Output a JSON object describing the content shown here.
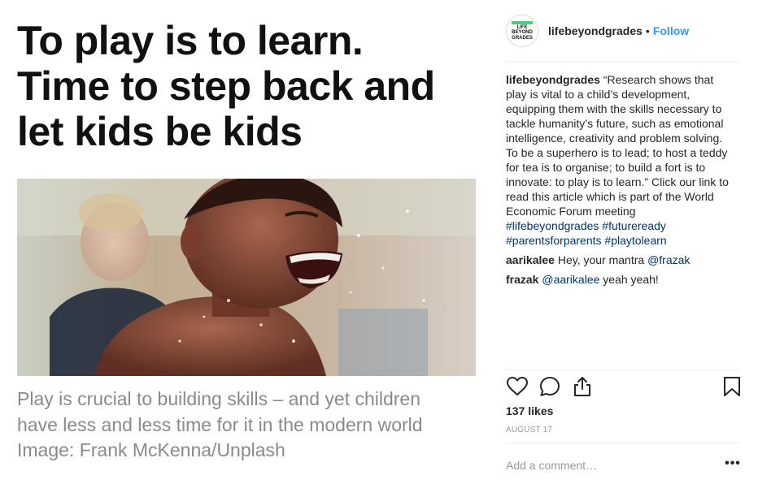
{
  "media": {
    "headline_lines": [
      "To play is to learn.",
      "Time to step back and",
      "let kids be kids"
    ],
    "caption_lines": [
      "Play is crucial to building skills – and yet children",
      "have less and less time for it in the modern world",
      "Image: Frank McKenna/Unplash"
    ]
  },
  "header": {
    "avatar_text": "LIFE BEYOND GRADES",
    "username": "lifebeyondgrades",
    "separator": "•",
    "follow_label": "Follow"
  },
  "caption_post": {
    "username": "lifebeyondgrades",
    "first_line": "“Research shows that",
    "lines": [
      "play is vital to a child’s development,",
      "equipping them with the skills necessary to",
      "tackle humanity’s future, such as emotional",
      "intelligence, creativity and problem solving.",
      "To be a superhero is to lead; to host a teddy",
      "for tea is to organise; to build a fort is to",
      "innovate: to play is to learn.” Click our link to",
      "read this article which is part of the World",
      "Economic Forum meeting"
    ],
    "hashtags_line1": "#lifebeyondgrades #futureready",
    "hashtags_line2": "#parentsforparents #playtolearn"
  },
  "comments": [
    {
      "username": "aarikalee",
      "text": "Hey, your mantra ",
      "mention": "@frazak",
      "after": ""
    },
    {
      "username": "frazak",
      "text": "",
      "mention": "@aarikalee",
      "after": " yeah yeah!"
    }
  ],
  "actions": {
    "like_icon": "heart-icon",
    "comment_icon": "comment-icon",
    "share_icon": "share-icon",
    "save_icon": "bookmark-icon"
  },
  "likes": "137 likes",
  "date": "AUGUST 17",
  "add_comment_placeholder": "Add a comment…",
  "more_label": "•••",
  "colors": {
    "link_blue": "#3897f0",
    "hashtag_navy": "#003569",
    "muted_gray": "#999999",
    "caption_gray": "#8a8a8a"
  }
}
